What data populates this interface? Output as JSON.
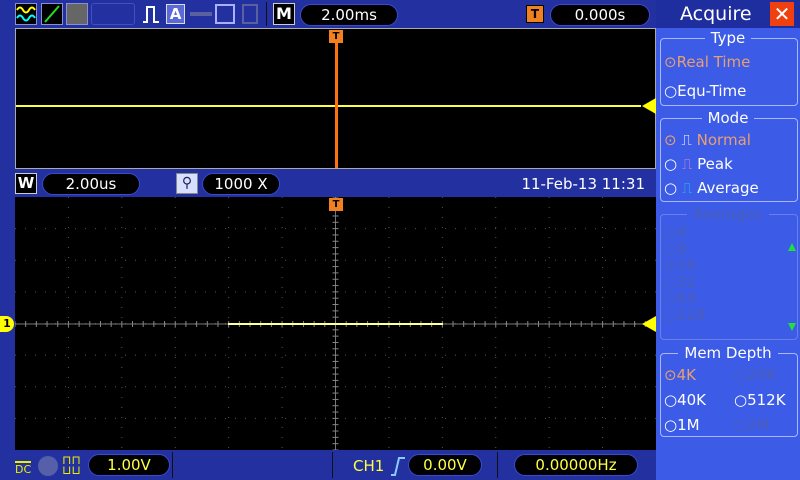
{
  "topbar": {
    "timebase": "2.00ms",
    "menu_key": "M",
    "trigger_pos": "0.000s"
  },
  "zoom_bar": {
    "window_key": "W",
    "window_timebase": "2.00us",
    "zoom_factor": "1000 X",
    "datetime": "11-Feb-13 11:31"
  },
  "bottombar": {
    "coupling": "DC",
    "ch1_scale": "1.00V",
    "trigger_source": "CH1",
    "trigger_level": "0.00V",
    "frequency": "0.00000Hz"
  },
  "channel_marker": "1",
  "trigger_marker": "T",
  "panel": {
    "title": "Acquire",
    "type": {
      "title": "Type",
      "options": [
        "Real Time",
        "Equ-Time"
      ],
      "selected": "Real Time"
    },
    "mode": {
      "title": "Mode",
      "options": [
        "Normal",
        "Peak",
        "Average"
      ],
      "selected": "Normal"
    },
    "averages": {
      "title": "Averages",
      "options": [
        "4",
        "8",
        "16",
        "32",
        "64",
        "128"
      ],
      "selected": "16"
    },
    "mem_depth": {
      "title": "Mem Depth",
      "options": [
        "4K",
        "20K",
        "40K",
        "512K",
        "1M",
        "2M"
      ],
      "selected": "4K"
    }
  },
  "colors": {
    "ch1": "#ffff40",
    "trigger": "#ff7010",
    "panel": "#3c5be6",
    "bar": "#23309f"
  }
}
